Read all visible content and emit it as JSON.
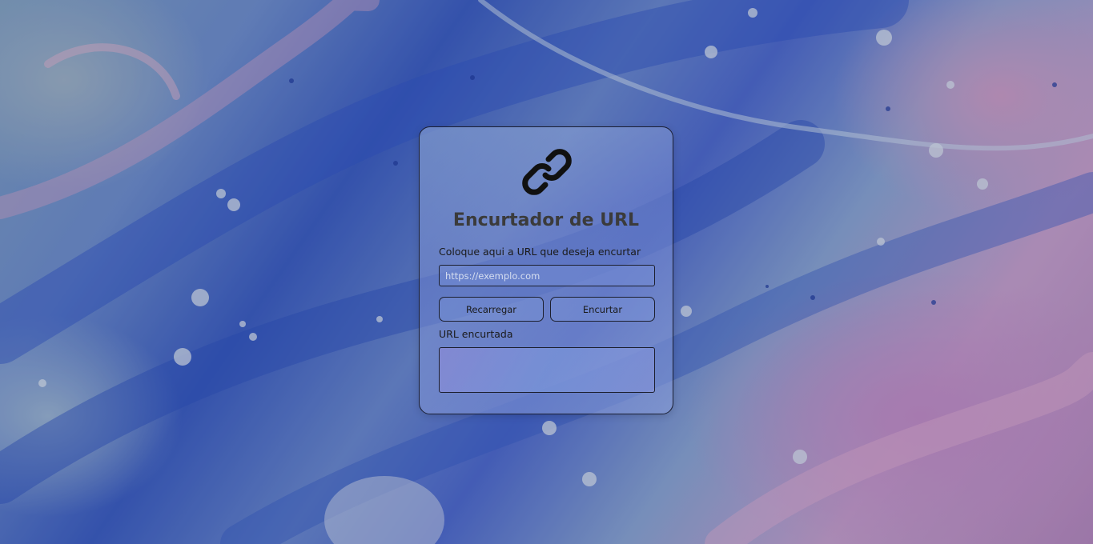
{
  "app": {
    "title": "Encurtador de URL",
    "logo_icon": "link-icon"
  },
  "form": {
    "input_label": "Coloque aqui a URL que deseja encurtar",
    "input_placeholder": "https://exemplo.com",
    "input_value": "",
    "reload_label": "Recarregar",
    "shorten_label": "Encurtar",
    "result_label": "URL encurtada",
    "result_value": ""
  },
  "colors": {
    "title": "#3b3b3b",
    "border": "#1c1f2e"
  }
}
